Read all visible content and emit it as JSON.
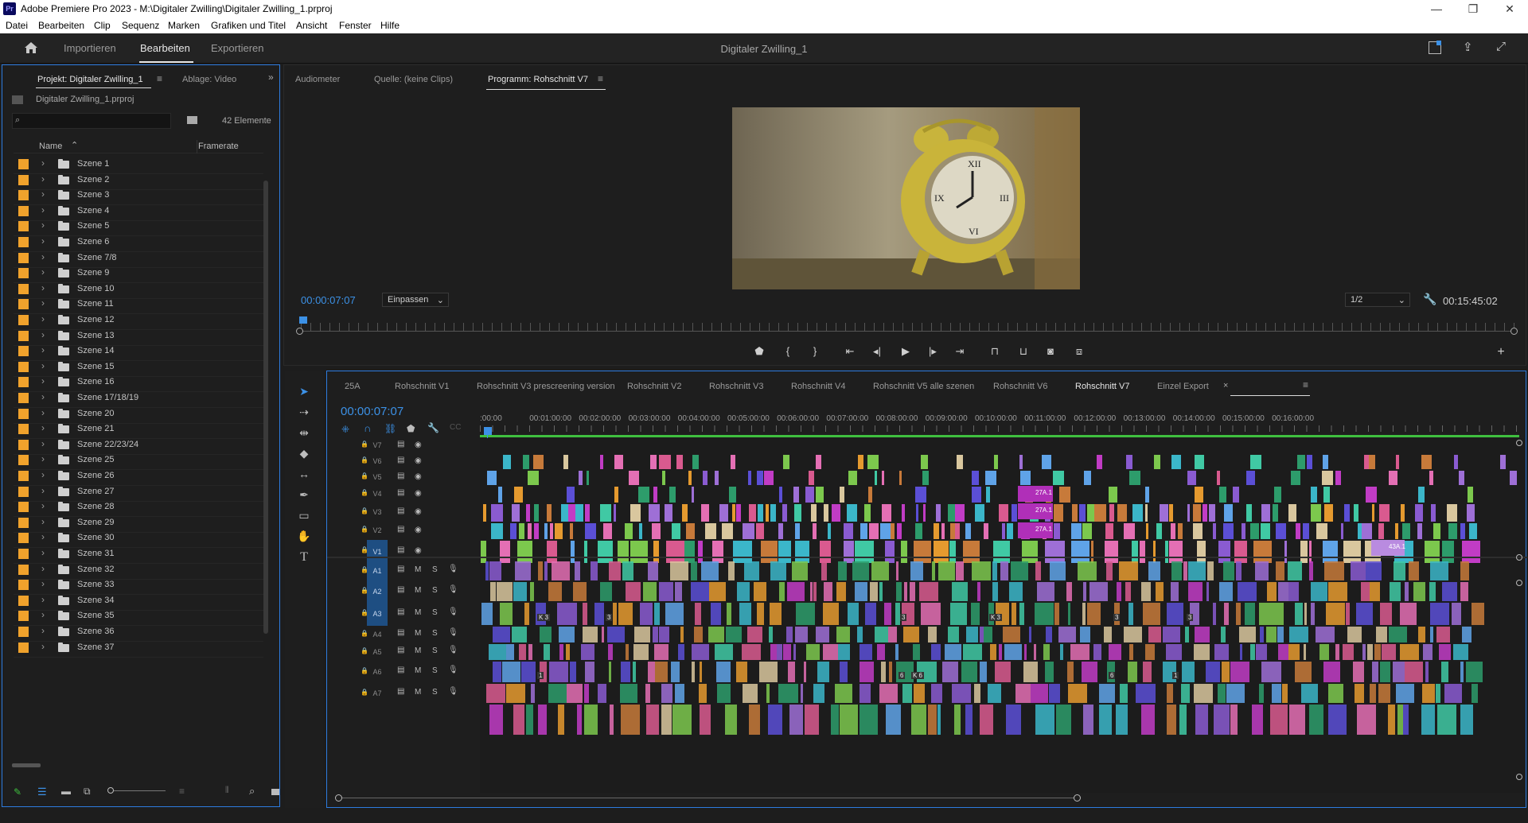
{
  "app": {
    "title": "Adobe Premiere Pro 2023 - M:\\Digitaler Zwilling\\Digitaler Zwilling_1.prproj",
    "icon": "Pr"
  },
  "window_controls": {
    "minimize": "—",
    "maximize": "❐",
    "close": "✕"
  },
  "menu": [
    "Datei",
    "Bearbeiten",
    "Clip",
    "Sequenz",
    "Marken",
    "Grafiken und Titel",
    "Ansicht",
    "Fenster",
    "Hilfe"
  ],
  "workspace": {
    "tabs": [
      "Importieren",
      "Bearbeiten",
      "Exportieren"
    ],
    "active": "Bearbeiten",
    "project_name": "Digitaler Zwilling_1"
  },
  "project_panel": {
    "tabs": [
      "Projekt: Digitaler Zwilling_1",
      "Ablage: Video"
    ],
    "file": "Digitaler Zwilling_1.prproj",
    "search_placeholder": "",
    "count": "42 Elemente",
    "columns": [
      "Name",
      "Framerate"
    ],
    "items": [
      "Szene 1",
      "Szene 2",
      "Szene 3",
      "Szene 4",
      "Szene 5",
      "Szene 6",
      "Szene 7/8",
      "Szene 9",
      "Szene 10",
      "Szene 11",
      "Szene 12",
      "Szene 13",
      "Szene 14",
      "Szene 15",
      "Szene 16",
      "Szene 17/18/19",
      "Szene 20",
      "Szene 21",
      "Szene 22/23/24",
      "Szene 25",
      "Szene 26",
      "Szene 27",
      "Szene 28",
      "Szene 29",
      "Szene 30",
      "Szene 31",
      "Szene 32",
      "Szene 33",
      "Szene 34",
      "Szene 35",
      "Szene 36",
      "Szene 37"
    ],
    "label_color": "#f0a22c"
  },
  "monitor": {
    "tabs": [
      "Audiometer",
      "Quelle: (keine Clips)",
      "Programm: Rohschnitt V7"
    ],
    "timecode": "00:00:07:07",
    "fit": "Einpassen",
    "resolution": "1/2",
    "duration": "00:15:45:02"
  },
  "timeline": {
    "sequences": [
      "25A",
      "Rohschnitt V1",
      "Rohschnitt V3 prescreening version",
      "Rohschnitt V2",
      "Rohschnitt V3",
      "Rohschnitt V4",
      "Rohschnitt V5 alle szenen",
      "Rohschnitt V6",
      "Rohschnitt V7",
      "Einzel Export"
    ],
    "active": "Rohschnitt V7",
    "timecode": "00:00:07:07",
    "ruler": [
      ":00:00",
      "00:01:00:00",
      "00:02:00:00",
      "00:03:00:00",
      "00:04:00:00",
      "00:05:00:00",
      "00:06:00:00",
      "00:07:00:00",
      "00:08:00:00",
      "00:09:00:00",
      "00:10:00:00",
      "00:11:00:00",
      "00:12:00:00",
      "00:13:00:00",
      "00:14:00:00",
      "00:15:00:00",
      "00:16:00:00"
    ],
    "video_tracks": [
      "V7",
      "V6",
      "V5",
      "V4",
      "V3",
      "V2",
      "V1"
    ],
    "audio_tracks": [
      "A1",
      "A2",
      "A3",
      "A4",
      "A5",
      "A6",
      "A7"
    ],
    "clip_labels": [
      "27A.1",
      "27A.1",
      "27A.1",
      "43A.1"
    ],
    "clip_numbers": [
      "K 3",
      "3",
      "3",
      "K 3",
      "3",
      "3",
      "1",
      "6",
      "K 6",
      "6",
      "1"
    ]
  }
}
